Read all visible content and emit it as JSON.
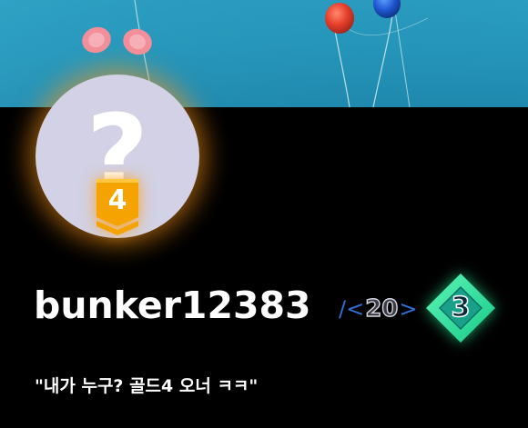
{
  "profile": {
    "username": "bunker12383",
    "tier_number": "4",
    "avatar_placeholder": "?",
    "level": {
      "open": "/<",
      "value": "20",
      "close": ">"
    },
    "rank_number": "3",
    "bio": "\"내가 누구? 골드4 오너 ㅋㅋ\""
  },
  "colors": {
    "background": "#000000",
    "banner": "#2596ba",
    "avatar_fill": "#d2d1e5",
    "tier_badge": "#f5a300",
    "level_bracket": "#2f6fd6",
    "rank_diamond": "#2ee89a"
  },
  "icons": {
    "avatar": "question-mark-icon",
    "tier": "gold-tier-badge-icon",
    "rank": "diamond-rank-icon",
    "banner": "balloons-photo"
  }
}
